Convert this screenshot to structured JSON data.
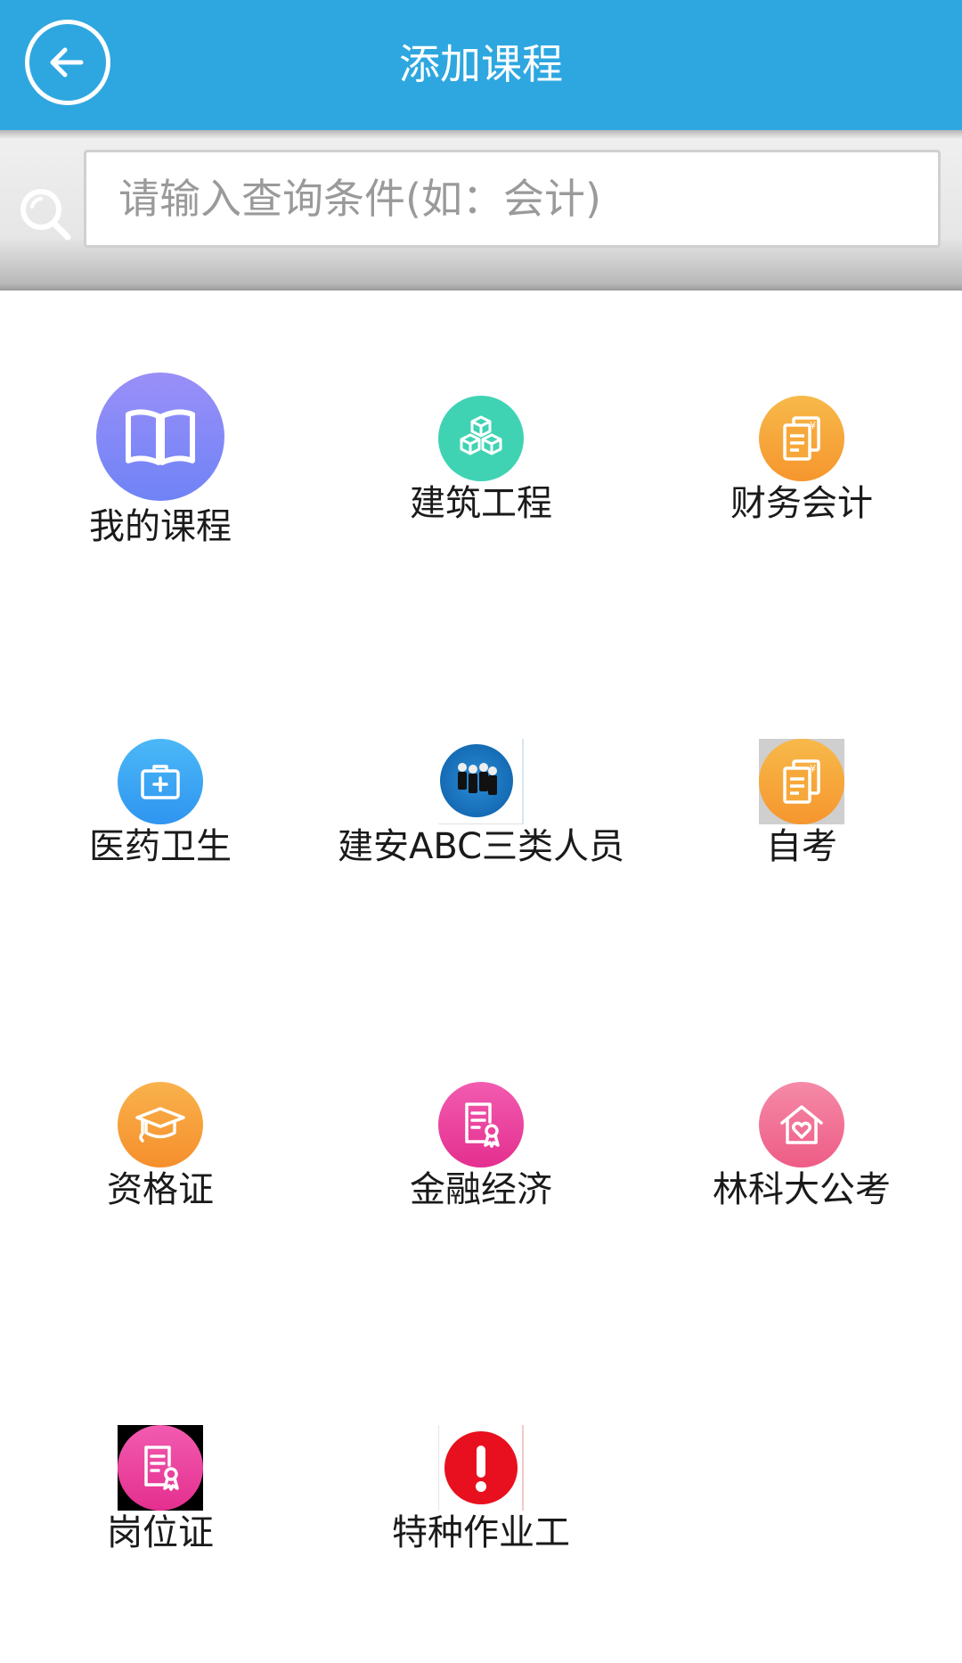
{
  "header": {
    "title": "添加课程",
    "back_icon": "arrow-left-circle-icon",
    "background": "#2ea7e0"
  },
  "search": {
    "placeholder": "请输入查询条件(如：会计)",
    "icon": "search-icon"
  },
  "categories": [
    {
      "label": "我的课程",
      "icon": "open-book-icon",
      "color": "#7b86f7"
    },
    {
      "label": "建筑工程",
      "icon": "cubes-icon",
      "color": "#3fd3b4"
    },
    {
      "label": "财务会计",
      "icon": "invoice-yen-icon",
      "color": "#f7a23a"
    },
    {
      "label": "医药卫生",
      "icon": "medical-kit-icon",
      "color": "#3aa8f5"
    },
    {
      "label": "建安ABC三类人员",
      "icon": "people-group-icon",
      "color": "#1066b0"
    },
    {
      "label": "自考",
      "icon": "invoice-yen-icon",
      "color": "#f7a23a"
    },
    {
      "label": "资格证",
      "icon": "graduation-cap-icon",
      "color": "#f79a3a"
    },
    {
      "label": "金融经济",
      "icon": "certificate-icon",
      "color": "#ec3f9e"
    },
    {
      "label": "林科大公考",
      "icon": "house-heart-icon",
      "color": "#f06c92"
    },
    {
      "label": "岗位证",
      "icon": "certificate-icon",
      "color": "#ec3f9e"
    },
    {
      "label": "特种作业工",
      "icon": "exclamation-icon",
      "color": "#e8101e"
    }
  ]
}
